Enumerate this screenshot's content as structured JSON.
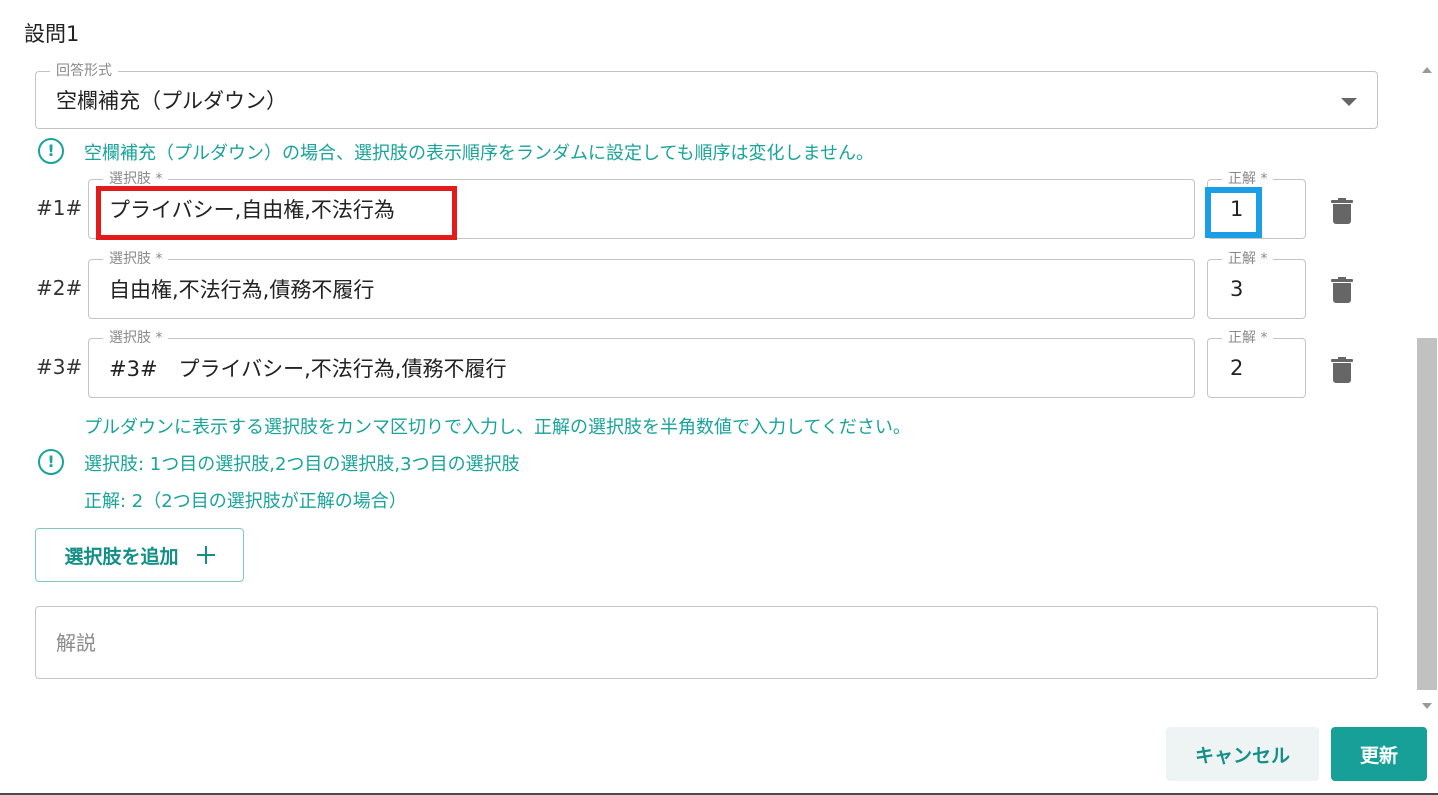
{
  "dialog": {
    "title": "設問1"
  },
  "answer_format": {
    "label": "回答形式",
    "value": "空欄補充（プルダウン）"
  },
  "notice": "空欄補充（プルダウン）の場合、選択肢の表示順序をランダムに設定しても順序は変化しません。",
  "choices": [
    {
      "index_label": "#1#",
      "choice_label": "選択肢 *",
      "choice_value": "プライバシー,自由権,不法行為",
      "correct_label": "正解 *",
      "correct_value": "1"
    },
    {
      "index_label": "#2#",
      "choice_label": "選択肢 *",
      "choice_value": "自由権,不法行為,債務不履行",
      "correct_label": "正解 *",
      "correct_value": "3"
    },
    {
      "index_label": "#3#",
      "choice_label": "選択肢 *",
      "choice_value": "#3#　プライバシー,不法行為,債務不履行",
      "correct_label": "正解 *",
      "correct_value": "2"
    }
  ],
  "help": {
    "line1": "プルダウンに表示する選択肢をカンマ区切りで入力し、正解の選択肢を半角数値で入力してください。",
    "line2": "選択肢: 1つ目の選択肢,2つ目の選択肢,3つ目の選択肢",
    "line3": "正解: 2（2つ目の選択肢が正解の場合）"
  },
  "add_choice_label": "選択肢を追加",
  "explanation": {
    "placeholder": "解説"
  },
  "footer": {
    "cancel_label": "キャンセル",
    "update_label": "更新"
  },
  "colors": {
    "accent": "#17a098",
    "highlight_red": "#e31b1b",
    "highlight_blue": "#1a9ee6"
  }
}
